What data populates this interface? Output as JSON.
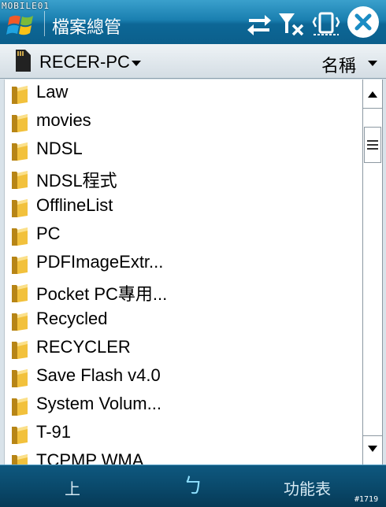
{
  "watermark": "MOBILE01",
  "app_title": "檔案總管",
  "location": {
    "name": "RECER-PC",
    "sort_label": "名稱"
  },
  "files": [
    {
      "name": "Law",
      "icon": "folder-icon"
    },
    {
      "name": "movies",
      "icon": "folder-icon"
    },
    {
      "name": "NDSL",
      "icon": "folder-icon"
    },
    {
      "name": "NDSL程式",
      "icon": "folder-icon"
    },
    {
      "name": "OfflineList",
      "icon": "folder-icon"
    },
    {
      "name": "PC",
      "icon": "folder-icon"
    },
    {
      "name": "PDFImageExtr...",
      "icon": "folder-icon"
    },
    {
      "name": "Pocket PC專用...",
      "icon": "folder-icon"
    },
    {
      "name": "Recycled",
      "icon": "folder-icon"
    },
    {
      "name": "RECYCLER",
      "icon": "folder-icon"
    },
    {
      "name": "Save Flash v4.0",
      "icon": "folder-icon"
    },
    {
      "name": "System Volum...",
      "icon": "folder-icon"
    },
    {
      "name": "T-91",
      "icon": "folder-icon"
    },
    {
      "name": "TCPMP WMA",
      "icon": "folder-icon"
    }
  ],
  "softkeys": {
    "left": "上",
    "center": "ㄅ",
    "right": "功能表"
  },
  "image_number": "#1719",
  "colors": {
    "titlebar": "#1a7fb0",
    "softbar": "#0a4a6c",
    "folder": "#e8b22a"
  }
}
